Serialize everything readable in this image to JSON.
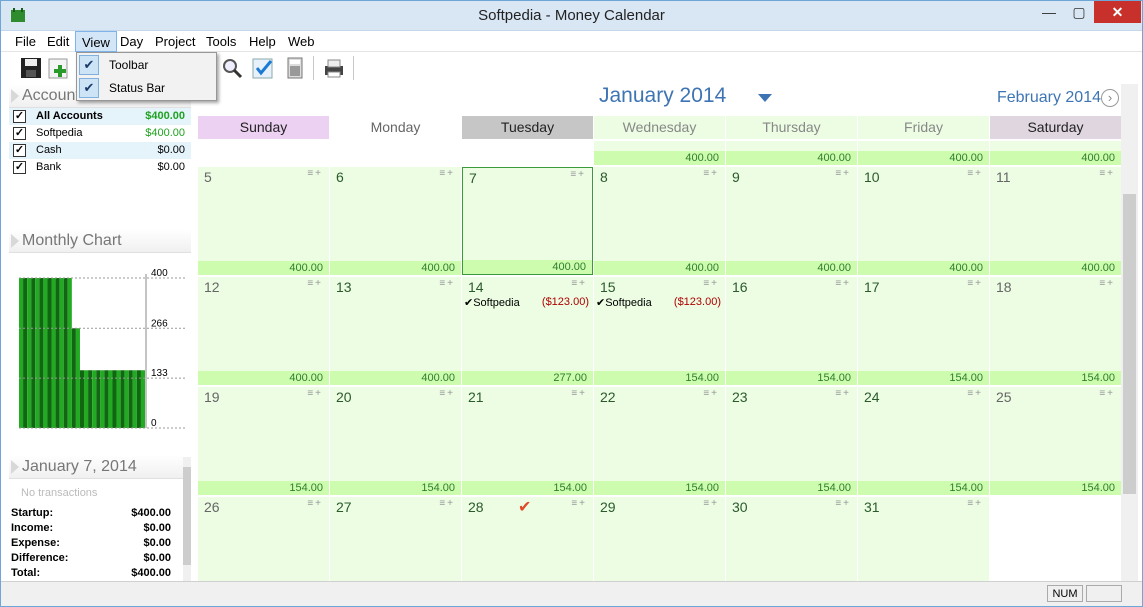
{
  "window": {
    "title": "Softpedia - Money Calendar",
    "min": "—",
    "max": "▢",
    "close": "✕"
  },
  "menu": {
    "items": [
      "File",
      "Edit",
      "View",
      "Day",
      "Project",
      "Tools",
      "Help",
      "Web"
    ],
    "dropdown": [
      {
        "label": "Toolbar",
        "checked": true
      },
      {
        "label": "Status Bar",
        "checked": true
      }
    ]
  },
  "toolbar": {
    "icons": [
      "save-icon",
      "add-transaction-icon",
      "search-icon",
      "reconcile-icon",
      "calculator-icon",
      "print-icon"
    ]
  },
  "accounts": {
    "title": "Accounts",
    "rows": [
      {
        "name": "All Accounts",
        "value": "$400.00",
        "bold": true
      },
      {
        "name": "Softpedia",
        "value": "$400.00"
      },
      {
        "name": "Cash",
        "value": "$0.00"
      },
      {
        "name": "Bank",
        "value": "$0.00"
      }
    ]
  },
  "chart_panel": {
    "title": "Monthly Chart"
  },
  "chart_data": {
    "type": "bar",
    "title": "Monthly Chart",
    "yticks": [
      "400",
      "266",
      "133",
      "0"
    ],
    "ylim": [
      0,
      400
    ],
    "colors": {
      "bar": "#22aa22",
      "dark": "#116611"
    },
    "values": [
      400,
      400,
      400,
      400,
      400,
      400,
      400,
      400,
      400,
      400,
      400,
      400,
      400,
      266,
      266,
      154,
      154,
      154,
      154,
      154,
      154,
      154,
      154,
      154,
      154,
      154,
      154,
      154,
      154,
      154,
      154
    ]
  },
  "day_panel": {
    "title": "January 7, 2014",
    "empty": "No transactions",
    "summary": [
      {
        "label": "Startup:",
        "value": "$400.00"
      },
      {
        "label": "Income:",
        "value": "$0.00"
      },
      {
        "label": "Expense:",
        "value": "$0.00"
      },
      {
        "label": "Difference:",
        "value": "$0.00"
      },
      {
        "label": "Total:",
        "value": "$400.00"
      }
    ]
  },
  "calendar": {
    "month": "January 2014",
    "next_month": "February 2014",
    "days": [
      {
        "name": "Sunday",
        "bg": "#ecd1f2"
      },
      {
        "name": "Monday",
        "bg": "#ffffff"
      },
      {
        "name": "Tuesday",
        "bg": "#c6c6c6"
      },
      {
        "name": "Wednesday",
        "bg": "#ecfde3"
      },
      {
        "name": "Thursday",
        "bg": "#ecfde3"
      },
      {
        "name": "Friday",
        "bg": "#ecfde3"
      },
      {
        "name": "Saturday",
        "bg": "#e0d6e0"
      }
    ],
    "top_balances": [
      "400.00",
      "400.00",
      "400.00",
      "400.00"
    ],
    "weeks": [
      [
        {
          "d": "5",
          "b": "400.00"
        },
        {
          "d": "6",
          "b": "400.00"
        },
        {
          "d": "7",
          "b": "400.00",
          "sel": true
        },
        {
          "d": "8",
          "b": "400.00"
        },
        {
          "d": "9",
          "b": "400.00"
        },
        {
          "d": "10",
          "b": "400.00"
        },
        {
          "d": "11",
          "b": "400.00"
        }
      ],
      [
        {
          "d": "12",
          "b": "400.00"
        },
        {
          "d": "13",
          "b": "400.00"
        },
        {
          "d": "14",
          "b": "277.00",
          "tx": "✔Softpedia",
          "amt": "($123.00)"
        },
        {
          "d": "15",
          "b": "154.00",
          "tx": "✔Softpedia",
          "amt": "($123.00)"
        },
        {
          "d": "16",
          "b": "154.00"
        },
        {
          "d": "17",
          "b": "154.00"
        },
        {
          "d": "18",
          "b": "154.00"
        }
      ],
      [
        {
          "d": "19",
          "b": "154.00"
        },
        {
          "d": "20",
          "b": "154.00"
        },
        {
          "d": "21",
          "b": "154.00"
        },
        {
          "d": "22",
          "b": "154.00"
        },
        {
          "d": "23",
          "b": "154.00"
        },
        {
          "d": "24",
          "b": "154.00"
        },
        {
          "d": "25",
          "b": "154.00"
        }
      ],
      [
        {
          "d": "26",
          "b": ""
        },
        {
          "d": "27",
          "b": ""
        },
        {
          "d": "28",
          "b": "",
          "mark": "✔"
        },
        {
          "d": "29",
          "b": ""
        },
        {
          "d": "30",
          "b": ""
        },
        {
          "d": "31",
          "b": ""
        },
        {
          "d": "",
          "b": "",
          "empty": true
        }
      ]
    ]
  },
  "status": {
    "num": "NUM"
  }
}
